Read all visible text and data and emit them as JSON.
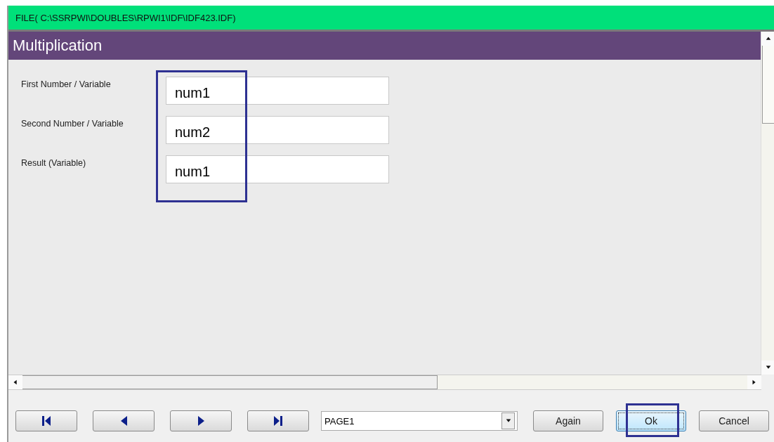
{
  "window": {
    "title": "FILE( C:\\SSRPWI\\DOUBLES\\RPWI1\\IDF\\IDF423.IDF)"
  },
  "form": {
    "title": "Multiplication",
    "fields_highlighted": true,
    "fields": [
      {
        "label": "First Number / Variable",
        "value": "num1"
      },
      {
        "label": "Second Number / Variable",
        "value": "num2"
      },
      {
        "label": "Result (Variable)",
        "value": "num1"
      }
    ]
  },
  "toolbar": {
    "nav_buttons": [
      {
        "kind": "first"
      },
      {
        "kind": "prev"
      },
      {
        "kind": "next"
      },
      {
        "kind": "last"
      }
    ],
    "page_select": {
      "value": "PAGE1"
    },
    "buttons": [
      {
        "label": "Again",
        "focused": false,
        "highlighted": false
      },
      {
        "label": "Ok",
        "focused": true,
        "highlighted": true
      },
      {
        "label": "Cancel",
        "focused": false,
        "highlighted": false
      }
    ]
  }
}
